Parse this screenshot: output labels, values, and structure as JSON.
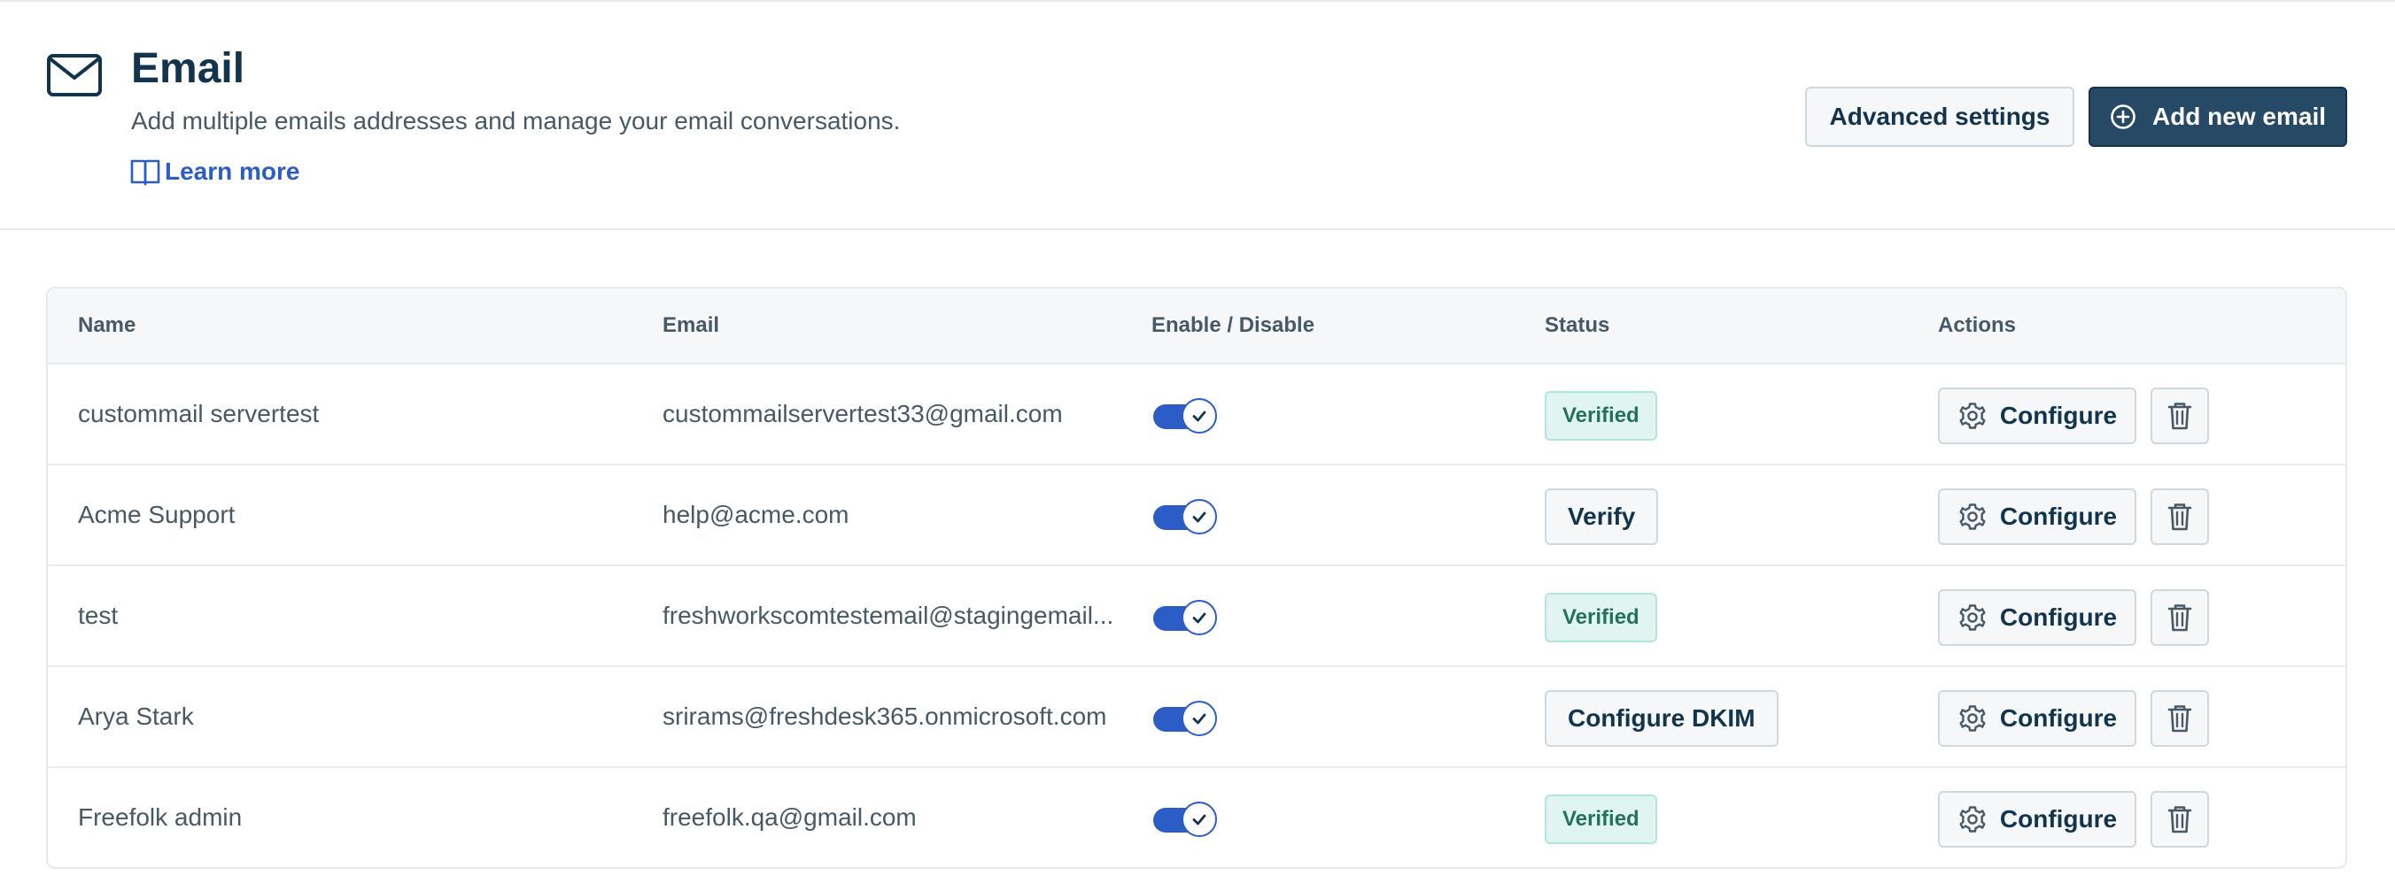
{
  "header": {
    "title": "Email",
    "subtitle": "Add multiple emails addresses and manage your email conversations.",
    "learn_more": "Learn more",
    "advanced_settings": "Advanced settings",
    "add_new_email": "Add new email",
    "icons": {
      "title": "envelope-icon",
      "learn_more": "book-icon",
      "add": "plus-circle-icon"
    }
  },
  "colors": {
    "accent": "#2c5cc5",
    "primary_button": "#264966",
    "verified_bg": "#e0f5f1",
    "verified_text": "#24715e"
  },
  "table": {
    "columns": [
      "Name",
      "Email",
      "Enable / Disable",
      "Status",
      "Actions"
    ],
    "configure_label": "Configure",
    "rows": [
      {
        "name": "custommail servertest",
        "email": "custommailservertest33@gmail.com",
        "enabled": true,
        "status": "Verified"
      },
      {
        "name": "Acme Support",
        "email": "help@acme.com",
        "enabled": true,
        "status": "Verify"
      },
      {
        "name": "test",
        "email": "freshworkscomtestemail@stagingemail...",
        "enabled": true,
        "status": "Verified"
      },
      {
        "name": "Arya Stark",
        "email": "srirams@freshdesk365.onmicrosoft.com",
        "enabled": true,
        "status": "Configure DKIM"
      },
      {
        "name": "Freefolk admin",
        "email": "freefolk.qa@gmail.com",
        "enabled": true,
        "status": "Verified"
      }
    ]
  }
}
